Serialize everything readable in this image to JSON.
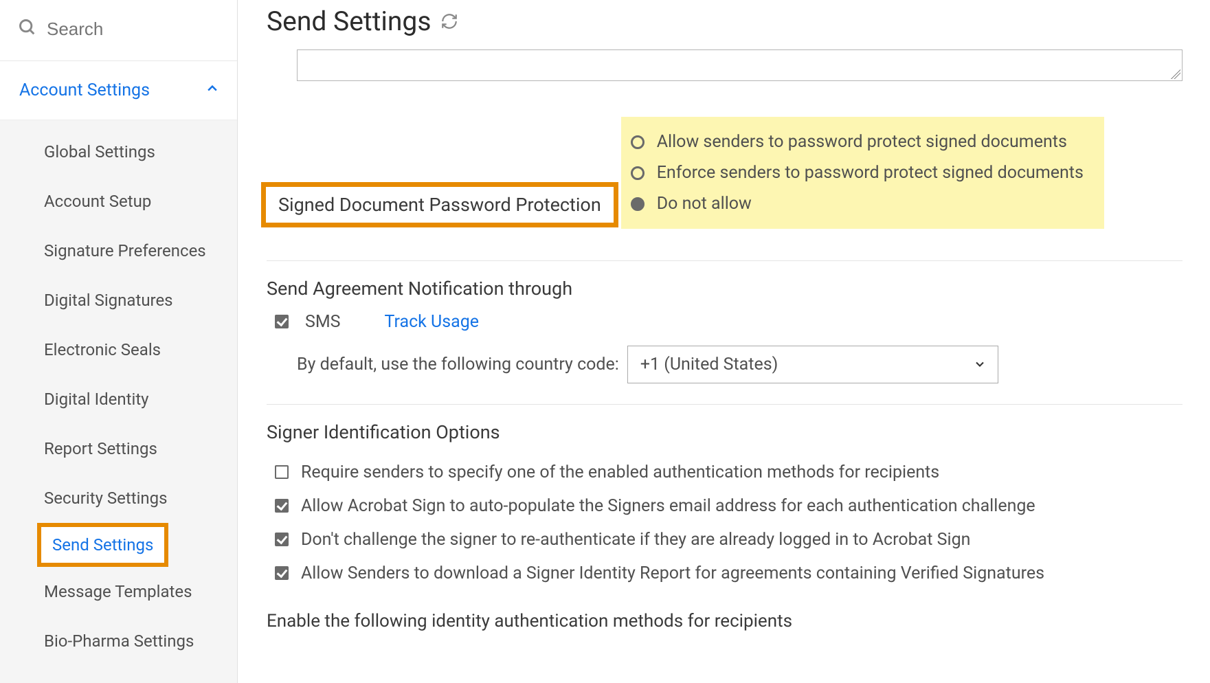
{
  "sidebar": {
    "search_placeholder": "Search",
    "section_label": "Account Settings",
    "items": [
      {
        "label": "Global Settings"
      },
      {
        "label": "Account Setup"
      },
      {
        "label": "Signature Preferences"
      },
      {
        "label": "Digital Signatures"
      },
      {
        "label": "Electronic Seals"
      },
      {
        "label": "Digital Identity"
      },
      {
        "label": "Report Settings"
      },
      {
        "label": "Security Settings"
      },
      {
        "label": "Send Settings",
        "active": true
      },
      {
        "label": "Message Templates"
      },
      {
        "label": "Bio-Pharma Settings"
      }
    ]
  },
  "main": {
    "title": "Send Settings",
    "password_protection": {
      "heading": "Signed Document Password Protection",
      "options": [
        {
          "label": "Allow senders to password protect signed documents",
          "selected": false
        },
        {
          "label": "Enforce senders to password protect signed documents",
          "selected": false
        },
        {
          "label": "Do not allow",
          "selected": true
        }
      ]
    },
    "notification": {
      "heading": "Send Agreement Notification through",
      "sms_label": "SMS",
      "sms_checked": true,
      "track_usage_label": "Track Usage",
      "country_label": "By default, use the following country code:",
      "country_value": "+1 (United States)"
    },
    "signer_id": {
      "heading": "Signer Identification Options",
      "options": [
        {
          "label": "Require senders to specify one of the enabled authentication methods for recipients",
          "checked": false
        },
        {
          "label": "Allow Acrobat Sign to auto-populate the Signers email address for each authentication challenge",
          "checked": true
        },
        {
          "label": "Don't challenge the signer to re-authenticate if they are already logged in to Acrobat Sign",
          "checked": true
        },
        {
          "label": "Allow Senders to download a Signer Identity Report for agreements containing Verified Signatures",
          "checked": true
        }
      ],
      "auth_heading": "Enable the following identity authentication methods for recipients"
    }
  }
}
